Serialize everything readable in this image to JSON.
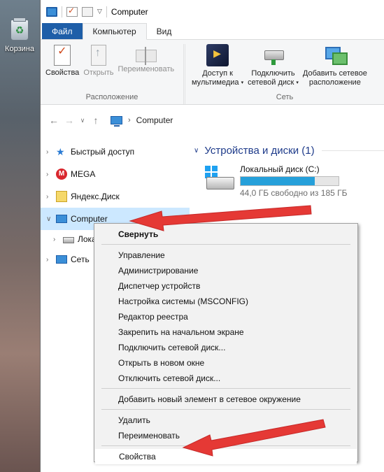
{
  "desktop": {
    "recycle_bin_label": "Корзина"
  },
  "window": {
    "title": "Computer",
    "tabs": [
      "Файл",
      "Компьютер",
      "Вид"
    ],
    "ribbon": {
      "groups": [
        {
          "label": "Расположение",
          "commands": [
            "Свойства",
            "Открыть",
            "Переименовать"
          ]
        },
        {
          "label": "Сеть",
          "commands": [
            {
              "line1": "Доступ к",
              "line2": "мультимедиа"
            },
            {
              "line1": "Подключить",
              "line2": "сетевой диск"
            },
            {
              "line1": "Добавить сетевое",
              "line2": "расположение"
            }
          ]
        }
      ]
    },
    "address": {
      "location": "Computer"
    },
    "nav": {
      "items": [
        "Быстрый доступ",
        "MEGA",
        "Яндекс.Диск",
        "Computer",
        "Лока",
        "Сеть"
      ]
    },
    "main": {
      "group_header": "Устройства и диски (1)",
      "drive": {
        "name": "Локальный диск (C:)",
        "free_text": "44,0 ГБ свободно из 185 ГБ",
        "used_fraction": 0.76
      }
    },
    "context_menu": {
      "items": [
        {
          "label": "Свернуть",
          "bold": true
        },
        {
          "sep": true
        },
        {
          "label": "Управление"
        },
        {
          "label": "Администрирование"
        },
        {
          "label": "Диспетчер устройств"
        },
        {
          "label": "Настройка системы (MSCONFIG)"
        },
        {
          "label": "Редактор реестра"
        },
        {
          "label": "Закрепить на начальном экране"
        },
        {
          "label": "Подключить сетевой диск..."
        },
        {
          "label": "Открыть в новом окне"
        },
        {
          "label": "Отключить сетевой диск..."
        },
        {
          "sep": true
        },
        {
          "label": "Добавить новый элемент в сетевое окружение"
        },
        {
          "sep": true
        },
        {
          "label": "Удалить"
        },
        {
          "label": "Переименовать"
        },
        {
          "sep": true
        },
        {
          "label": "Свойства",
          "highlight": true
        }
      ]
    }
  },
  "colors": {
    "accent": "#1e5ea8",
    "selection": "#cce8ff",
    "arrow": "#e53935",
    "bar_fill": "#26a0da"
  }
}
